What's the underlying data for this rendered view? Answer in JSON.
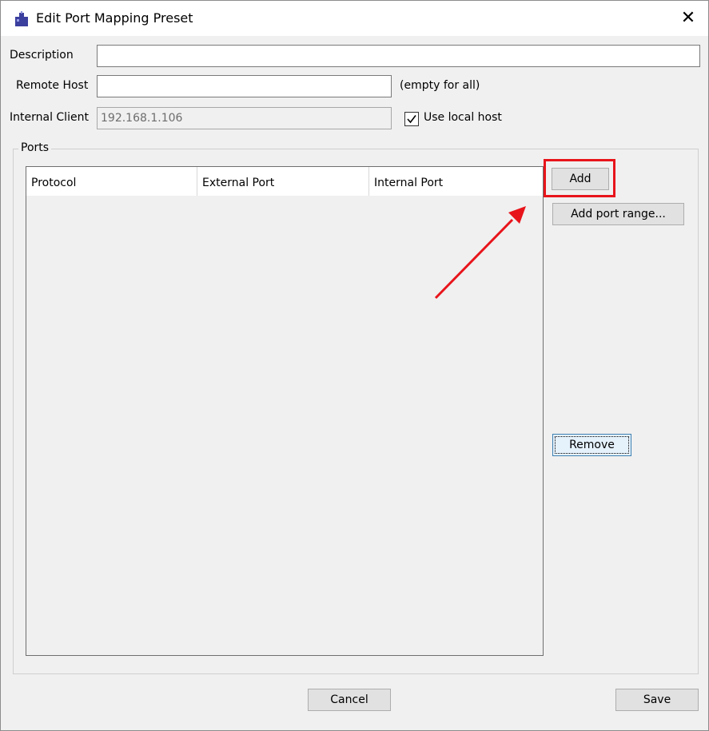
{
  "window": {
    "title": "Edit Port Mapping Preset",
    "close_glyph": "✕",
    "app_icon": "puzzle-app-icon"
  },
  "form": {
    "description_label": "Description",
    "description_value": "",
    "remote_host_label": "Remote Host",
    "remote_host_value": "",
    "remote_host_hint": "(empty for all)",
    "internal_client_label": "Internal Client",
    "internal_client_value": "192.168.1.106",
    "use_local_host_label": "Use local host",
    "use_local_host_checked": true
  },
  "ports": {
    "group_title": "Ports",
    "columns": [
      "Protocol",
      "External Port",
      "Internal Port"
    ],
    "rows": [],
    "buttons": {
      "add": "Add",
      "add_range": "Add port range...",
      "remove": "Remove"
    }
  },
  "footer": {
    "cancel": "Cancel",
    "save": "Save"
  },
  "annotation": {
    "highlight_color": "#e8141b",
    "arrow_color": "#e8141b"
  }
}
